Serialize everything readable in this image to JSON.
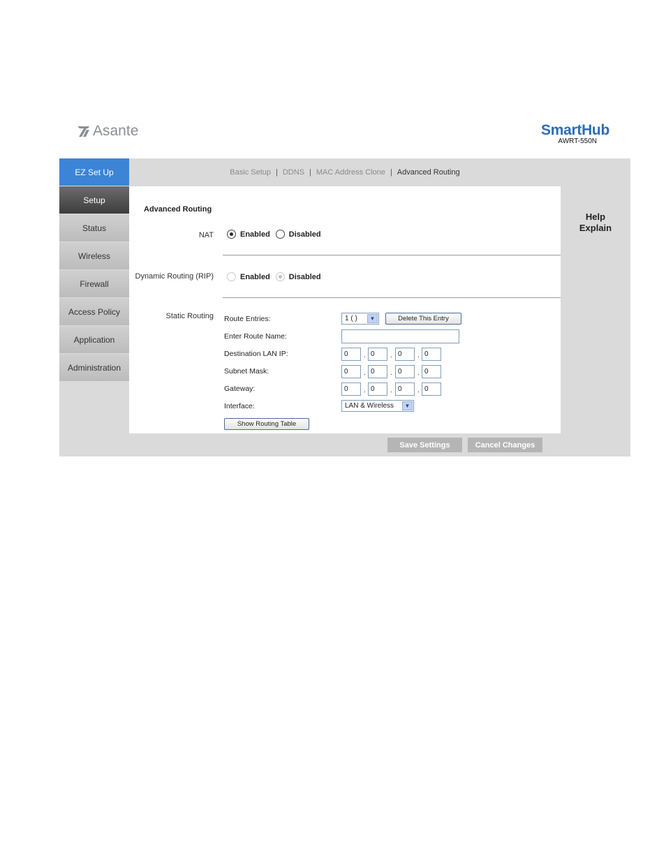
{
  "header": {
    "logo_text": "Asante",
    "brand_name": "SmartHub",
    "model": "AWRT-550N"
  },
  "sidebar": {
    "items": [
      {
        "label": "EZ Set Up"
      },
      {
        "label": "Setup"
      },
      {
        "label": "Status"
      },
      {
        "label": "Wireless"
      },
      {
        "label": "Firewall"
      },
      {
        "label": "Access Policy"
      },
      {
        "label": "Application"
      },
      {
        "label": "Administration"
      }
    ]
  },
  "subnav": {
    "items": [
      {
        "label": "Basic Setup"
      },
      {
        "label": "DDNS"
      },
      {
        "label": "MAC Address Clone"
      },
      {
        "label": "Advanced Routing"
      }
    ],
    "separator": "|"
  },
  "content": {
    "section_title": "Advanced Routing",
    "nat": {
      "label": "NAT",
      "enabled_label": "Enabled",
      "disabled_label": "Disabled",
      "selected": "Enabled"
    },
    "rip": {
      "label": "Dynamic Routing (RIP)",
      "enabled_label": "Enabled",
      "disabled_label": "Disabled",
      "selected": "Disabled"
    },
    "static": {
      "label": "Static Routing",
      "route_entries_label": "Route Entries:",
      "route_entries_value": "1 ( )",
      "delete_button": "Delete This Entry",
      "route_name_label": "Enter Route Name:",
      "route_name_value": "",
      "dest_label": "Destination LAN IP:",
      "dest_ip": [
        "0",
        "0",
        "0",
        "0"
      ],
      "subnet_label": "Subnet Mask:",
      "subnet_ip": [
        "0",
        "0",
        "0",
        "0"
      ],
      "gateway_label": "Gateway:",
      "gateway_ip": [
        "0",
        "0",
        "0",
        "0"
      ],
      "interface_label": "Interface:",
      "interface_value": "LAN & Wireless",
      "show_table_button": "Show Routing Table",
      "ip_separator": "."
    }
  },
  "actions": {
    "save": "Save Settings",
    "cancel": "Cancel Changes"
  },
  "help": {
    "title": "Help",
    "explain": "Explain"
  },
  "colors": {
    "ez_setup_bg": "#3c84d6",
    "brand_blue": "#2b6db5",
    "active_nav": "#4a4a4a",
    "frame_gray": "#dadada"
  }
}
